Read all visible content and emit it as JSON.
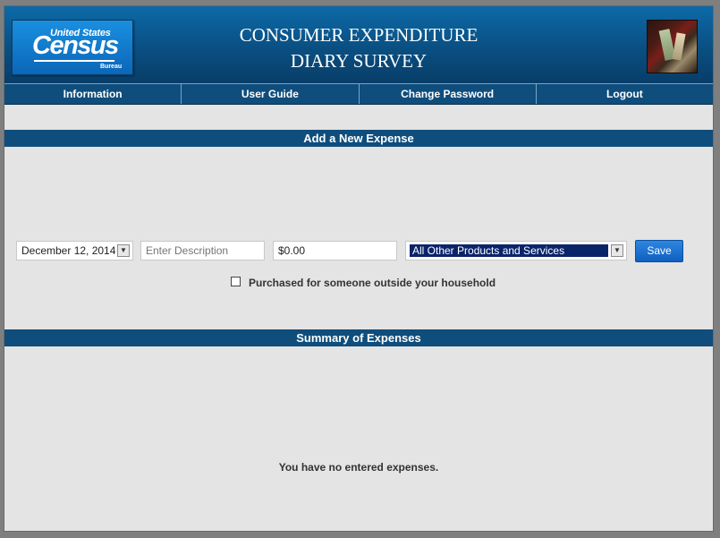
{
  "header": {
    "logo": {
      "top": "United States",
      "tm": "™",
      "main": "Census",
      "sub": "Bureau"
    },
    "title_line1": "CONSUMER EXPENDITURE",
    "title_line2": "DIARY SURVEY"
  },
  "nav": {
    "items": [
      {
        "label": "Information"
      },
      {
        "label": "User Guide"
      },
      {
        "label": "Change Password"
      },
      {
        "label": "Logout"
      }
    ]
  },
  "add_expense": {
    "heading": "Add a New Expense",
    "date_value": "December 12, 2014",
    "description_placeholder": "Enter Description",
    "amount_value": "$0.00",
    "category_value": "All Other Products and Services",
    "save_label": "Save",
    "checkbox_label": "Purchased for someone outside your household",
    "checkbox_checked": false
  },
  "summary": {
    "heading": "Summary of Expenses",
    "empty_message": "You have no entered expenses."
  },
  "colors": {
    "header_blue": "#0a4f82",
    "nav_blue": "#0f4d7c",
    "save_blue": "#1a6fd0",
    "panel_bg": "#e4e4e4"
  }
}
